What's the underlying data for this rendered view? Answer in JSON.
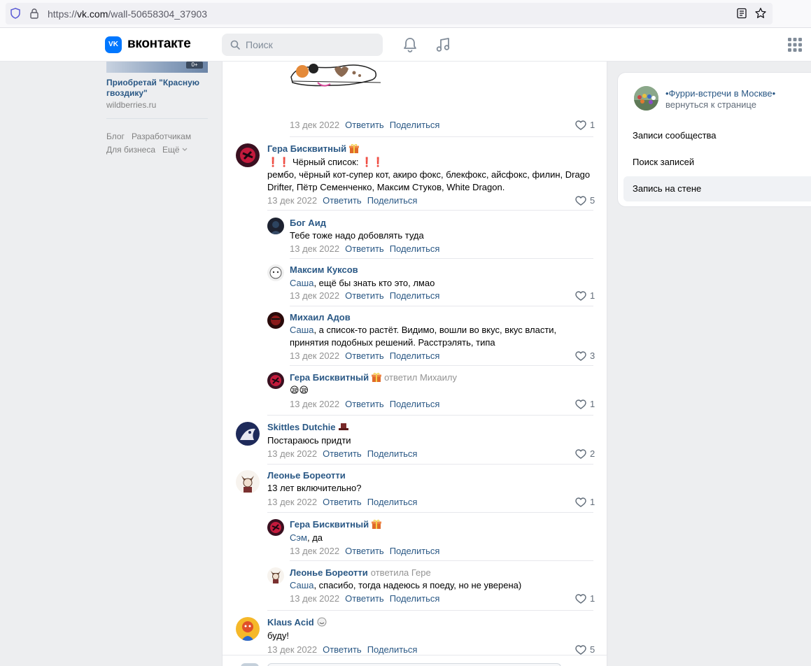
{
  "browser": {
    "url_prefix": "https://",
    "url_domain": "vk.com",
    "url_path": "/wall-50658304_37903"
  },
  "header": {
    "logo_letter": "VK",
    "brand": "вконтакте",
    "search_placeholder": "Поиск"
  },
  "left": {
    "ad_age": "0+",
    "ad_title": "Приобретай \"Красную гвоздику\"",
    "ad_site": "wildberries.ru",
    "links": [
      "Блог",
      "Разработчикам",
      "Для бизнеса",
      "Ещё"
    ]
  },
  "actions": {
    "reply": "Ответить",
    "share": "Поделиться"
  },
  "comments": [
    {
      "date": "13 дек 2022",
      "likes": "1"
    },
    {
      "author": "Гера Бисквитный",
      "line1": "Чёрный список:",
      "line2": "рембо, чёрный кот-супер кот, акиро фокс, блекфокс, айсфокс, филин, Drago Drifter, Пётр Семенченко, Максим Стуков, White Dragon.",
      "date": "13 дек 2022",
      "likes": "5"
    },
    {
      "author": "Бог Аид",
      "text": "Тебе тоже надо добовлять туда",
      "date": "13 дек 2022"
    },
    {
      "author": "Максим Куксов",
      "mention": "Саша",
      "text": ", ещё бы знать кто это, лмао",
      "date": "13 дек 2022",
      "likes": "1"
    },
    {
      "author": "Михаил Адов",
      "mention": "Саша",
      "text": ", а список-то растёт. Видимо, вошли во вкус, вкус власти, принятия подобных решений. Расстрэлять, типа",
      "date": "13 дек 2022",
      "likes": "3"
    },
    {
      "author": "Гера Бисквитный",
      "replied": "ответил Михаилу",
      "text": "😪😪",
      "date": "13 дек 2022",
      "likes": "1"
    },
    {
      "author": "Skittles Dutchie",
      "text": "Постараюсь придти",
      "date": "13 дек 2022",
      "likes": "2"
    },
    {
      "author": "Леонье Бореотти",
      "text": "13 лет включительно?",
      "date": "13 дек 2022",
      "likes": "1"
    },
    {
      "author": "Гера Бисквитный",
      "mention": "Сэм",
      "text": ", да",
      "date": "13 дек 2022"
    },
    {
      "author": "Леонье Бореотти",
      "replied": "ответила Гере",
      "mention": "Саша",
      "text": ", спасибо, тогда надеюсь я поеду, но не уверена)",
      "date": "13 дек 2022",
      "likes": "1"
    },
    {
      "author": "Klaus Acid",
      "text": "буду!",
      "date": "13 дек 2022",
      "likes": "5"
    }
  ],
  "right": {
    "group_name": "•Фурри-встречи в Москве•",
    "back": "вернуться к странице",
    "menu": [
      "Записи сообщества",
      "Поиск записей",
      "Запись на стене"
    ]
  }
}
